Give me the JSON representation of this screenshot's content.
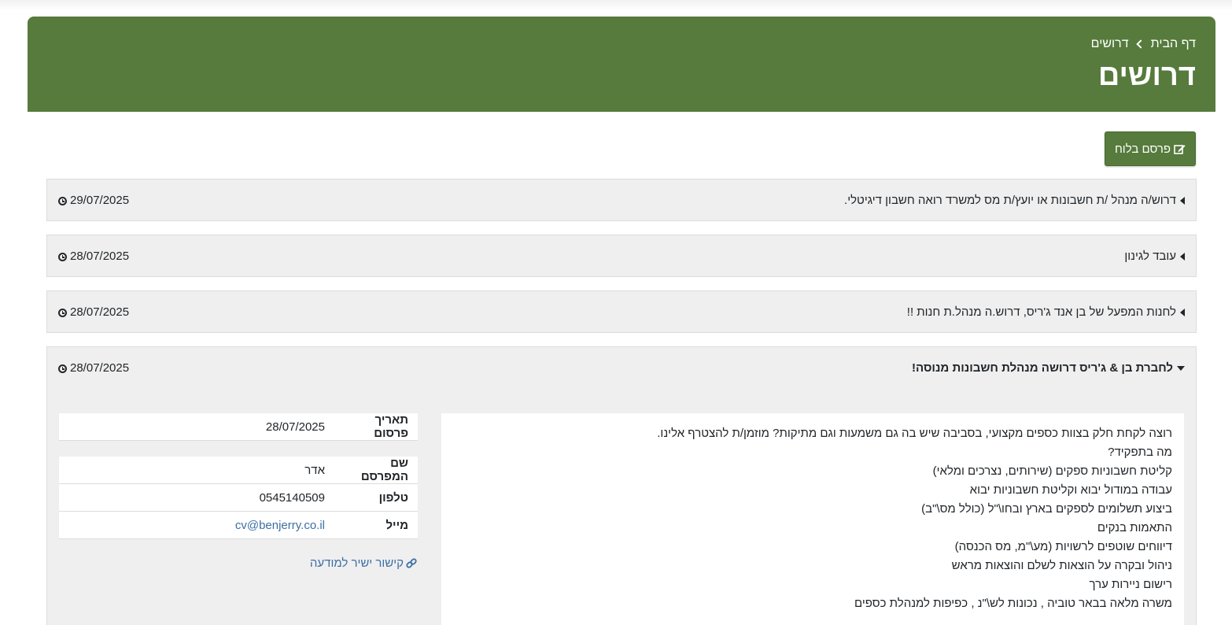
{
  "breadcrumb": {
    "home": "דף הבית",
    "current": "דרושים"
  },
  "page_title": "דרושים",
  "publish_button": {
    "label": "פרסם בלוח",
    "icon": "edit-icon"
  },
  "listings": [
    {
      "title": "דרוש/ה מנהל /ת חשבונות או יועץ/ת מס למשרד רואה חשבון דיגיטלי.",
      "date": "29/07/2025",
      "expanded": false
    },
    {
      "title": "עובד לגינון",
      "date": "28/07/2025",
      "expanded": false
    },
    {
      "title": "לחנות המפעל של בן אנד ג'ריס, דרוש.ה מנהל.ת חנות !!",
      "date": "28/07/2025",
      "expanded": false
    },
    {
      "title": "לחברת בן & ג'ריס דרושה מנהלת חשבונות מנוסה!",
      "date": "28/07/2025",
      "expanded": true
    }
  ],
  "expanded_item": {
    "publish_date_label": "תאריך פרסום",
    "publish_date": "28/07/2025",
    "publisher_label": "שם המפרסם",
    "publisher": "אדר",
    "phone_label": "טלפון",
    "phone": "0545140509",
    "email_label": "מייל",
    "email": "cv@benjerry.co.il",
    "direct_link": "קישור ישיר למודעה",
    "description_lines": [
      "רוצה לקחת חלק בצוות כספים מקצועי, בסביבה שיש בה גם משמעות וגם מתיקות? מוזמן/ת להצטרף אלינו.",
      "מה בתפקיד?",
      "קליטת חשבוניות ספקים (שירותים, נצרכים ומלאי)",
      "עבודה במודול יבוא וקליטת חשבוניות יבוא",
      "ביצוע תשלומים לספקים בארץ ובחו\\\"ל (כולל מס\\\"ב)",
      "התאמות בנקים",
      "דיווחים שוטפים לרשויות (מע\\\"מ, מס הכנסה)",
      "ניהול ובקרה על הוצאות לשלם והוצאות מראש",
      "רישום ניירות ערך",
      "משרה מלאה בבאר טוביה , נכונות לש\\\"נ , כפיפות למנהלת כספים"
    ]
  },
  "colors": {
    "header_bg": "#567b3c",
    "item_bg": "#efefef",
    "link": "#3c6fa5"
  }
}
